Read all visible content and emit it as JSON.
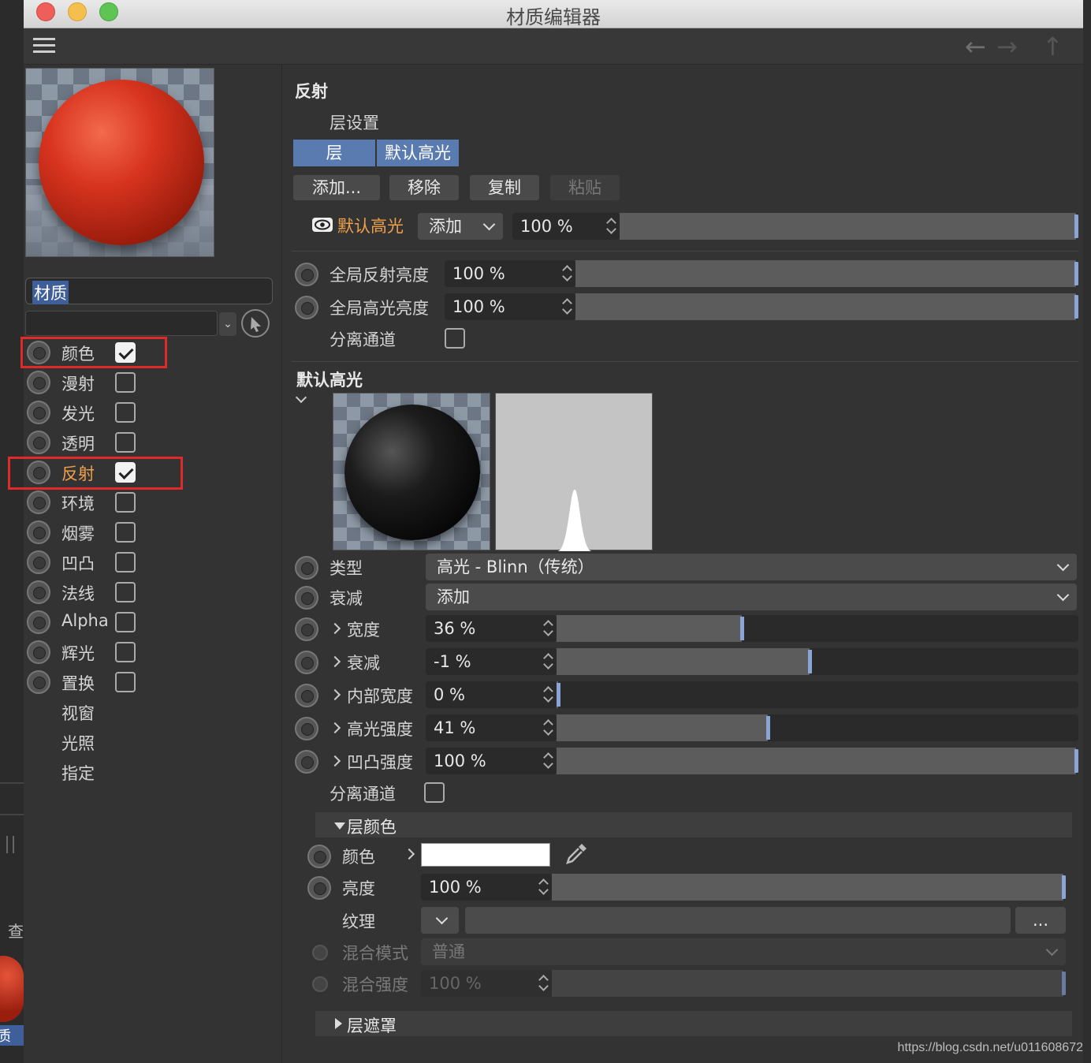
{
  "window": {
    "title": "材质编辑器"
  },
  "background_app": {
    "side_label": "查",
    "selected_label": "质"
  },
  "left": {
    "material_name": "材质",
    "channels": [
      {
        "label": "颜色",
        "checked": true,
        "active": false,
        "has_radio": true,
        "has_box": true
      },
      {
        "label": "漫射",
        "checked": false,
        "active": false,
        "has_radio": true,
        "has_box": true
      },
      {
        "label": "发光",
        "checked": false,
        "active": false,
        "has_radio": true,
        "has_box": true
      },
      {
        "label": "透明",
        "checked": false,
        "active": false,
        "has_radio": true,
        "has_box": true
      },
      {
        "label": "反射",
        "checked": true,
        "active": true,
        "has_radio": true,
        "has_box": true
      },
      {
        "label": "环境",
        "checked": false,
        "active": false,
        "has_radio": true,
        "has_box": true
      },
      {
        "label": "烟雾",
        "checked": false,
        "active": false,
        "has_radio": true,
        "has_box": true
      },
      {
        "label": "凹凸",
        "checked": false,
        "active": false,
        "has_radio": true,
        "has_box": true
      },
      {
        "label": "法线",
        "checked": false,
        "active": false,
        "has_radio": true,
        "has_box": true
      },
      {
        "label": "Alpha",
        "checked": false,
        "active": false,
        "has_radio": true,
        "has_box": true
      },
      {
        "label": "辉光",
        "checked": false,
        "active": false,
        "has_radio": true,
        "has_box": true
      },
      {
        "label": "置换",
        "checked": false,
        "active": false,
        "has_radio": true,
        "has_box": true
      },
      {
        "label": "视窗",
        "checked": false,
        "active": false,
        "has_radio": false,
        "has_box": false
      },
      {
        "label": "光照",
        "checked": false,
        "active": false,
        "has_radio": false,
        "has_box": false
      },
      {
        "label": "指定",
        "checked": false,
        "active": false,
        "has_radio": false,
        "has_box": false
      }
    ]
  },
  "reflect": {
    "section_title": "反射",
    "layer_settings": "层设置",
    "tabs": [
      "层",
      "默认高光"
    ],
    "buttons": {
      "add": "添加...",
      "remove": "移除",
      "copy": "复制",
      "paste": "粘贴"
    },
    "layer_row": {
      "name": "默认高光",
      "mode": "添加",
      "value": "100 %",
      "fraction": 1.0
    },
    "global_reflect": {
      "label": "全局反射亮度",
      "value": "100 %",
      "fraction": 1.0
    },
    "global_spec": {
      "label": "全局高光亮度",
      "value": "100 %",
      "fraction": 1.0
    },
    "separate_pass": {
      "label": "分离通道",
      "checked": false
    }
  },
  "default_spec": {
    "section_title": "默认高光",
    "type": {
      "label": "类型",
      "value": "高光 - Blinn（传统）"
    },
    "attenuation": {
      "label": "衰减",
      "value": "添加"
    },
    "params": [
      {
        "label": "宽度",
        "value": "36 %",
        "fraction": 0.36
      },
      {
        "label": "衰减",
        "value": "-1 %",
        "fraction": 0.49
      },
      {
        "label": "内部宽度",
        "value": "0 %",
        "fraction": 0.0
      },
      {
        "label": "高光强度",
        "value": "41 %",
        "fraction": 0.41
      },
      {
        "label": "凹凸强度",
        "value": "100 %",
        "fraction": 1.0
      }
    ],
    "separate_pass": {
      "label": "分离通道",
      "checked": false
    }
  },
  "layer_color": {
    "title": "层颜色",
    "color": {
      "label": "颜色",
      "swatch": "#ffffff"
    },
    "brightness": {
      "label": "亮度",
      "value": "100 %",
      "fraction": 1.0
    },
    "texture": {
      "label": "纹理",
      "more": "..."
    },
    "blend_mode": {
      "label": "混合模式",
      "value": "普通"
    },
    "blend_strength": {
      "label": "混合强度",
      "value": "100 %",
      "fraction": 1.0
    }
  },
  "layer_mask": {
    "title": "层遮罩"
  },
  "watermark": "https://blog.csdn.net/u011608672",
  "colors": {
    "accent": "#5a7bb0",
    "active_label": "#f0a04b",
    "highlight_box": "#e02a2a"
  }
}
